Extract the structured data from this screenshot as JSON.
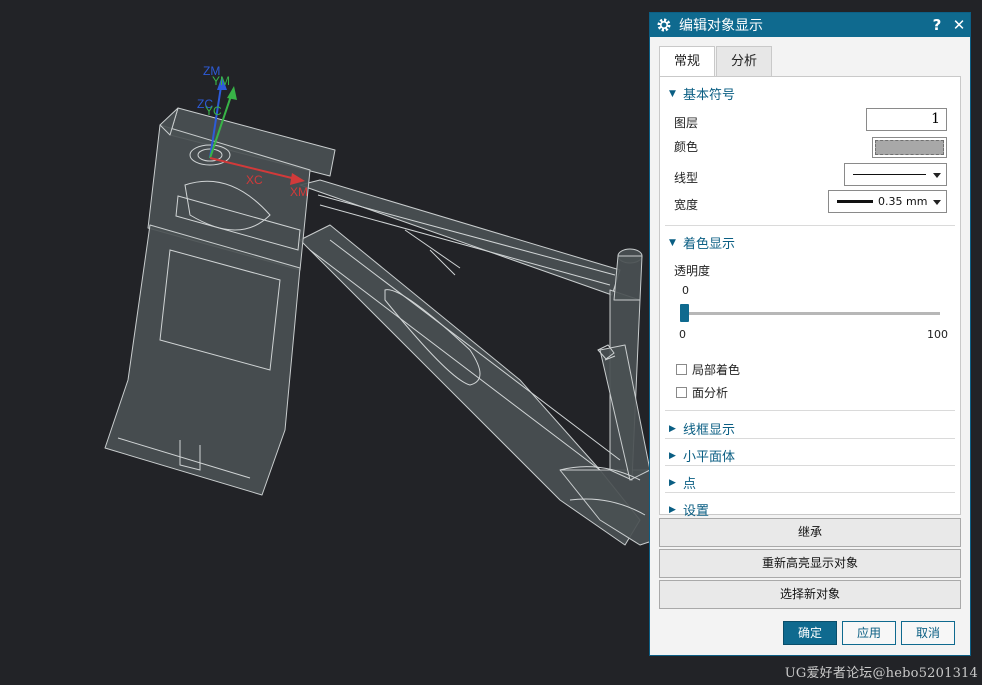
{
  "viewport": {
    "axes": {
      "zm": "ZM",
      "ym": "YM",
      "zc": "ZC",
      "yc": "YC",
      "xc": "XC",
      "xm": "XM"
    }
  },
  "watermark": "UG爱好者论坛@hebo5201314",
  "dialog": {
    "title": "编辑对象显示",
    "help_glyph": "?",
    "close_glyph": "✕",
    "tabs": [
      {
        "label": "常规"
      },
      {
        "label": "分析"
      }
    ],
    "sections": {
      "basic": {
        "label": "基本符号",
        "layer_label": "图层",
        "layer_value": "1",
        "color_label": "颜色",
        "color_value": "#a8a8a8",
        "linetype_label": "线型",
        "width_label": "宽度",
        "width_value": "0.35 mm"
      },
      "shading": {
        "label": "着色显示",
        "transparency_label": "透明度",
        "slider_value": "0",
        "slider_min": "0",
        "slider_max": "100",
        "slider_fraction": 0,
        "partial_shading_label": "局部着色",
        "face_analysis_label": "面分析"
      },
      "collapsed": [
        {
          "label": "线框显示"
        },
        {
          "label": "小平面体"
        },
        {
          "label": "点"
        },
        {
          "label": "设置"
        }
      ]
    },
    "buttons": {
      "inherit": "继承",
      "rehighlight": "重新高亮显示对象",
      "select_new": "选择新对象",
      "ok": "确定",
      "apply": "应用",
      "cancel": "取消"
    },
    "colors": {
      "accent": "#0f6a8f",
      "ok_bg": "#0f6a8f",
      "slider_handle": "#0f6a8f"
    }
  }
}
